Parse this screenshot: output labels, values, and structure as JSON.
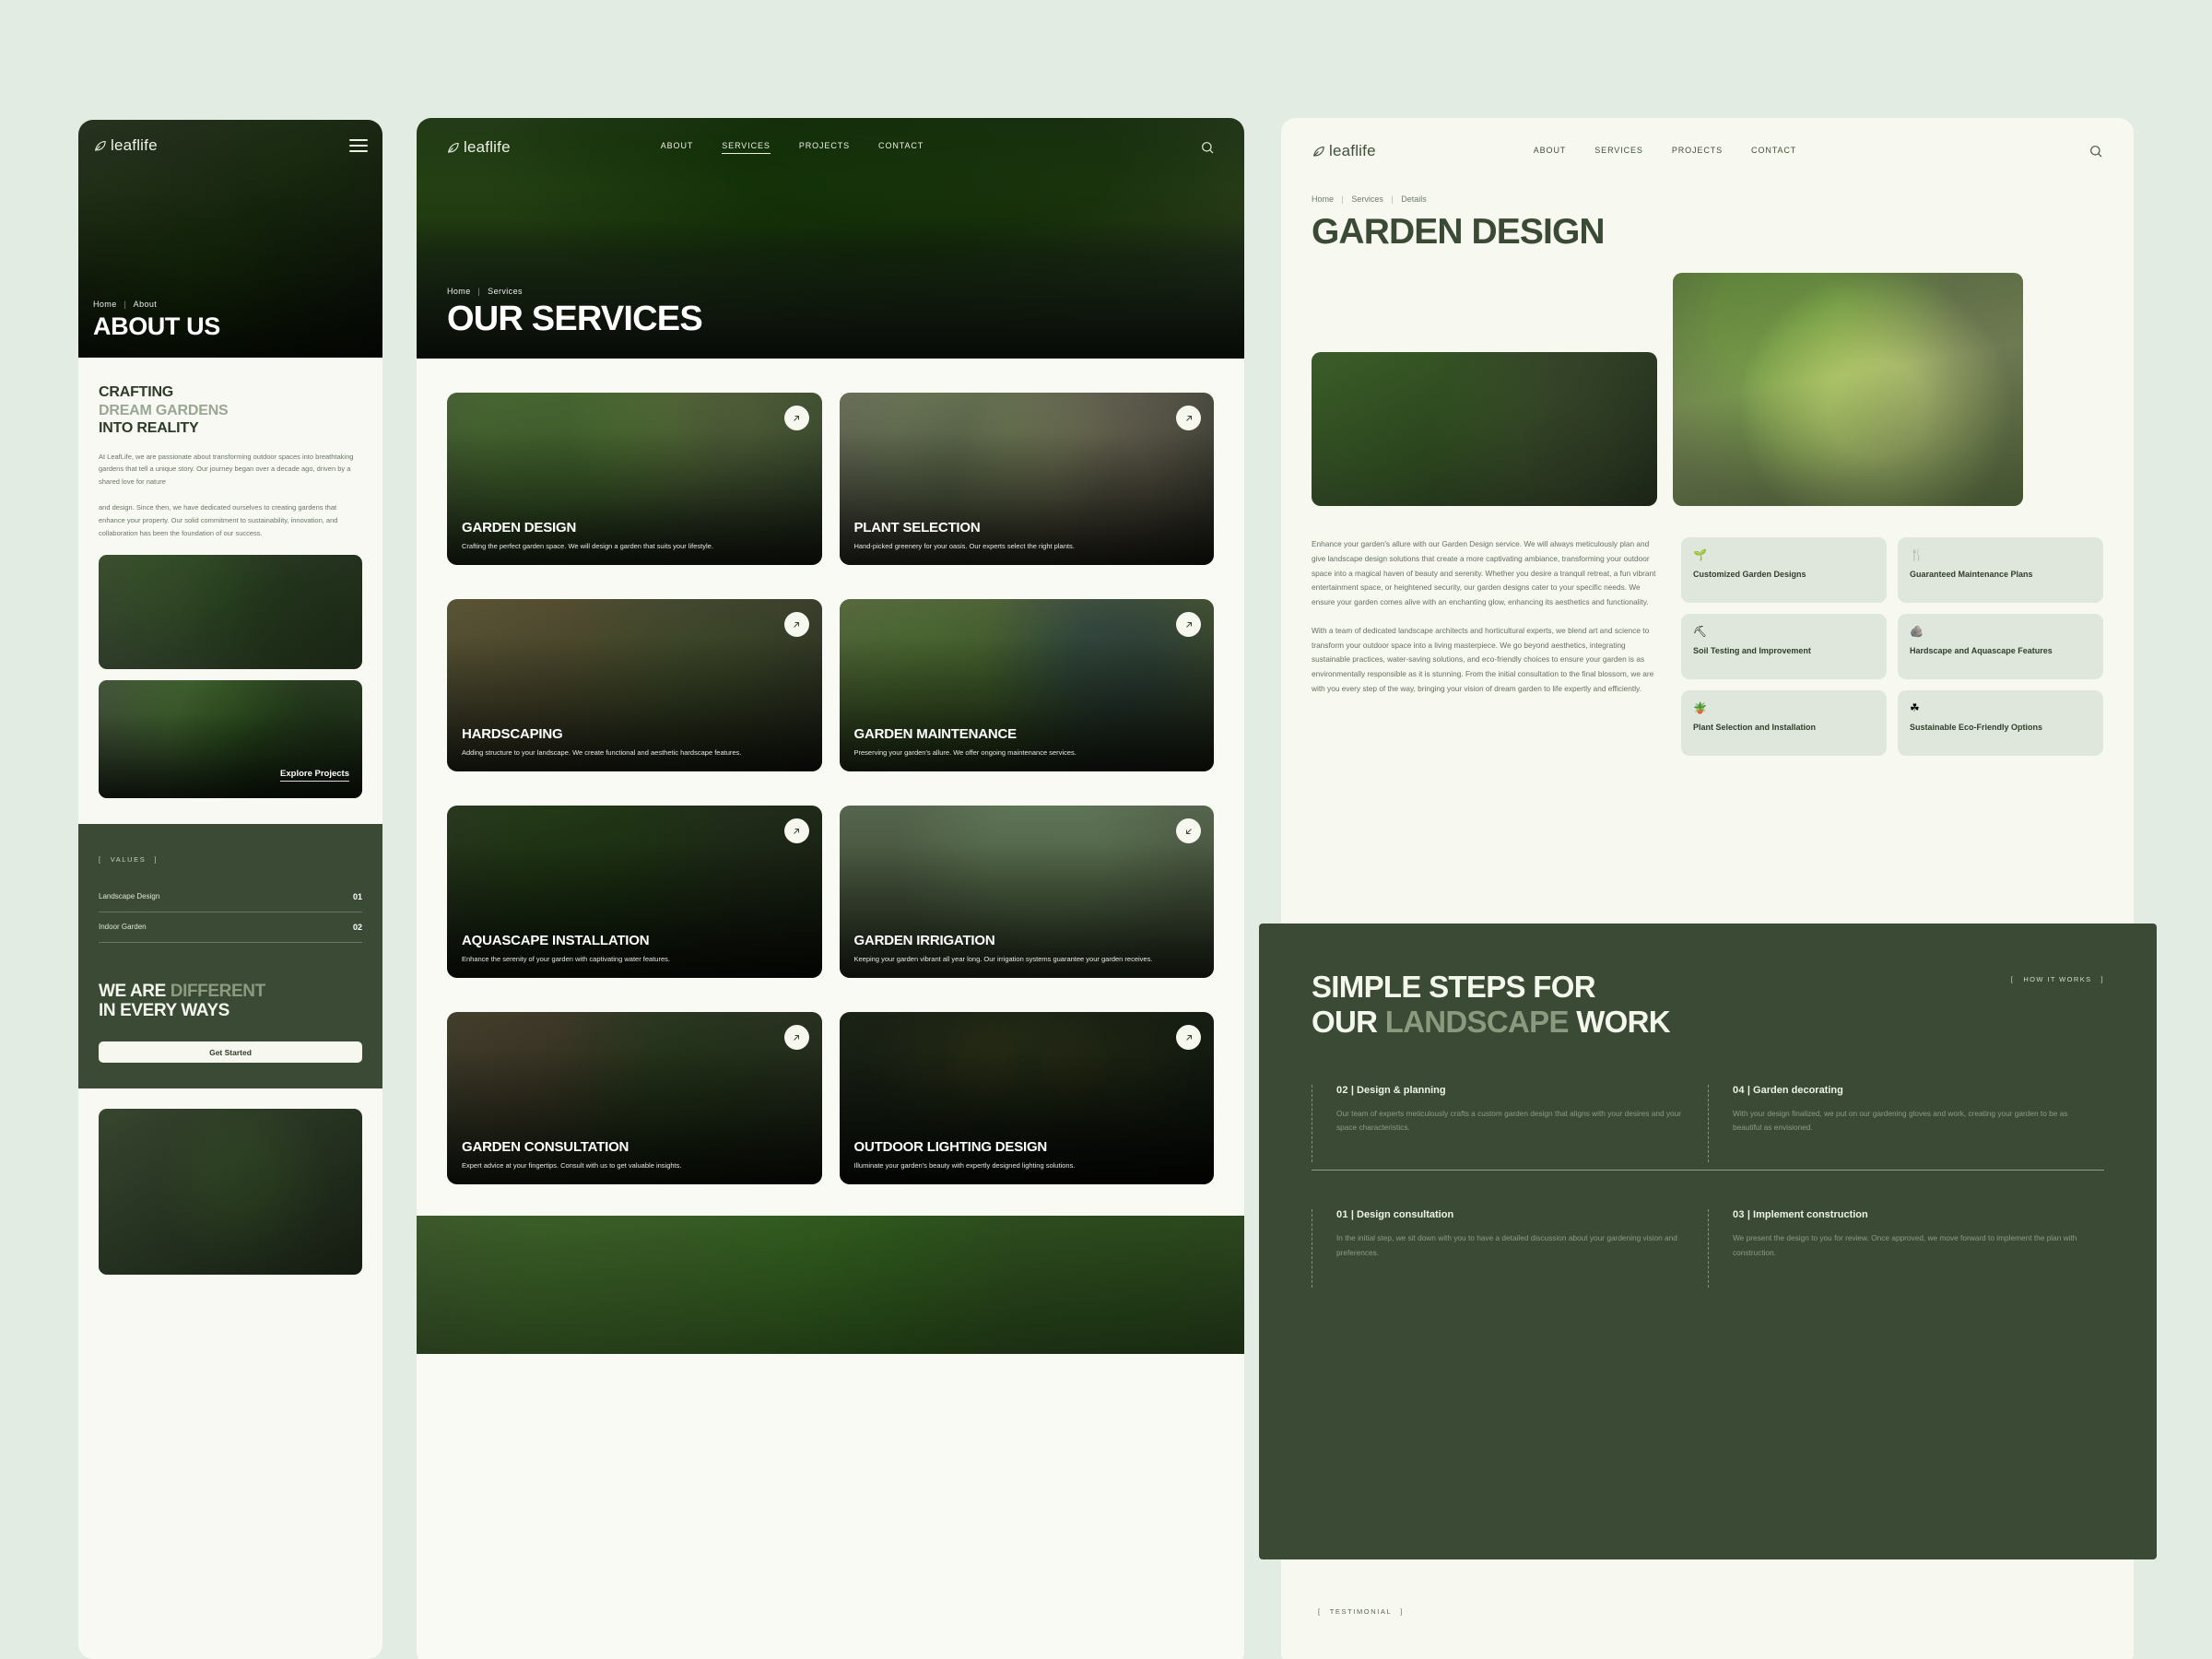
{
  "brand": {
    "name": "leaflife",
    "logo_icon": "leaf-icon"
  },
  "colors": {
    "page_bg": "#e3ece3",
    "cream": "#f7f9f2",
    "dark_green": "#3b4a35",
    "muted_green": "#8a9a7f",
    "card_green": "#dfe7dc"
  },
  "mobile_panel": {
    "menu_icon": "hamburger-icon",
    "breadcrumb": {
      "items": [
        "Home",
        "About"
      ],
      "separator": "|"
    },
    "hero_title": "ABOUT US",
    "heading": {
      "line1": "CRAFTING",
      "line2": "DREAM GARDENS",
      "line3": "INTO REALITY"
    },
    "paragraph1": "At LeafLife, we are passionate about transforming outdoor spaces into breathtaking gardens that tell a unique story. Our journey began over a decade ago, driven by a shared love for nature",
    "paragraph2": "and design. Since then, we have dedicated ourselves to creating gardens that enhance your property. Our solid commitment to sustainability, innovation, and collaboration has been the foundation of our success.",
    "explore_label": "Explore Projects",
    "values_badge": "VALUES",
    "values": [
      {
        "label": "Landscape Design",
        "number": "01"
      },
      {
        "label": "Indoor Garden",
        "number": "02"
      }
    ],
    "different_heading": {
      "a": "WE ARE ",
      "b": "DIFFERENT",
      "c": "IN EVERY WAYS"
    },
    "cta_label": "Get Started"
  },
  "services_panel": {
    "nav": [
      "ABOUT",
      "SERVICES",
      "PROJECTS",
      "CONTACT"
    ],
    "nav_active": "SERVICES",
    "search_icon": "search-icon",
    "breadcrumb": {
      "items": [
        "Home",
        "Services"
      ],
      "separator": "|"
    },
    "hero_title": "OUR SERVICES",
    "cards": [
      {
        "title": "GARDEN DESIGN",
        "desc": "Crafting the perfect garden space. We will design a garden that suits your lifestyle.",
        "arrow_icon": "arrow-up-right-icon"
      },
      {
        "title": "PLANT SELECTION",
        "desc": "Hand-picked greenery for your oasis. Our experts select the right plants.",
        "arrow_icon": "arrow-up-right-icon"
      },
      {
        "title": "HARDSCAPING",
        "desc": "Adding structure to your landscape. We create functional and aesthetic hardscape features.",
        "arrow_icon": "arrow-up-right-icon"
      },
      {
        "title": "GARDEN MAINTENANCE",
        "desc": "Preserving your garden's allure. We offer ongoing maintenance services.",
        "arrow_icon": "arrow-up-right-icon"
      },
      {
        "title": "AQUASCAPE INSTALLATION",
        "desc": "Enhance the serenity of your garden with captivating water features.",
        "arrow_icon": "arrow-up-right-icon"
      },
      {
        "title": "GARDEN IRRIGATION",
        "desc": "Keeping your garden vibrant all year long. Our irrigation systems guarantee your garden receives.",
        "arrow_icon": "arrow-down-left-icon"
      },
      {
        "title": "GARDEN CONSULTATION",
        "desc": "Expert advice at your fingertips. Consult with us to get valuable insights.",
        "arrow_icon": "arrow-up-right-icon"
      },
      {
        "title": "OUTDOOR LIGHTING DESIGN",
        "desc": "Illuminate your garden's beauty with expertly designed lighting solutions.",
        "arrow_icon": "arrow-up-right-icon"
      }
    ]
  },
  "detail_panel": {
    "nav": [
      "ABOUT",
      "SERVICES",
      "PROJECTS",
      "CONTACT"
    ],
    "search_icon": "search-icon",
    "breadcrumb": {
      "items": [
        "Home",
        "Services",
        "Details"
      ],
      "separator": "|"
    },
    "title": "GARDEN DESIGN",
    "paragraph1": "Enhance your garden's allure with our Garden Design service. We will always meticulously plan and give landscape design solutions that create a more captivating ambiance, transforming your outdoor space into a magical haven of beauty and serenity. Whether you desire a tranquil retreat, a fun vibrant entertainment space, or heightened security, our garden designs cater to your specific needs. We ensure your garden comes alive with an enchanting glow, enhancing its aesthetics and functionality.",
    "paragraph2": "With a team of dedicated landscape architects and horticultural experts, we blend art and science to transform your outdoor space into a living masterpiece. We go beyond aesthetics, integrating sustainable practices, water-saving solutions, and eco-friendly choices to ensure your garden is as environmentally responsible as it is stunning. From the initial consultation to the final blossom, we are with you every step of the way, bringing your vision of dream garden to life expertly and efficiently.",
    "features": [
      {
        "icon": "seedling-hand-icon",
        "glyph": "🌱",
        "label": "Customized Garden Designs"
      },
      {
        "icon": "fork-knife-icon",
        "glyph": "🍴",
        "label": "Guaranteed Maintenance Plans"
      },
      {
        "icon": "shovel-soil-icon",
        "glyph": "⛏",
        "label": "Soil Testing and Improvement"
      },
      {
        "icon": "stone-icon",
        "glyph": "🪨",
        "label": "Hardscape and Aquascape Features"
      },
      {
        "icon": "potted-plant-icon",
        "glyph": "🪴",
        "label": "Plant Selection and Installation"
      },
      {
        "icon": "eco-leaf-icon",
        "glyph": "☘",
        "label": "Sustainable Eco-Friendly Options"
      }
    ]
  },
  "steps_section": {
    "badge": "HOW IT WORKS",
    "heading": {
      "a": "SIMPLE STEPS FOR",
      "b": "OUR ",
      "c": "LANDSCAPE",
      "d": " WORK"
    },
    "upper": [
      {
        "number": "02",
        "sep": "|",
        "title": "Design & planning",
        "desc": "Our team of experts meticulously crafts a custom garden design that aligns with your desires and your space characteristics."
      },
      {
        "number": "04",
        "sep": "|",
        "title": "Garden decorating",
        "desc": "With your design finalized, we put on our gardening gloves and work, creating your garden to be as beautiful as envisioned."
      }
    ],
    "lower": [
      {
        "number": "01",
        "sep": "|",
        "title": "Design consultation",
        "desc": "In the initial step, we sit down with you to have a detailed discussion about your gardening vision and preferences."
      },
      {
        "number": "03",
        "sep": "|",
        "title": "Implement construction",
        "desc": "We present the design to you for review. Once approved, we move forward to implement the plan with construction."
      }
    ]
  },
  "testimonial_section": {
    "badge": "TESTIMONIAL"
  }
}
